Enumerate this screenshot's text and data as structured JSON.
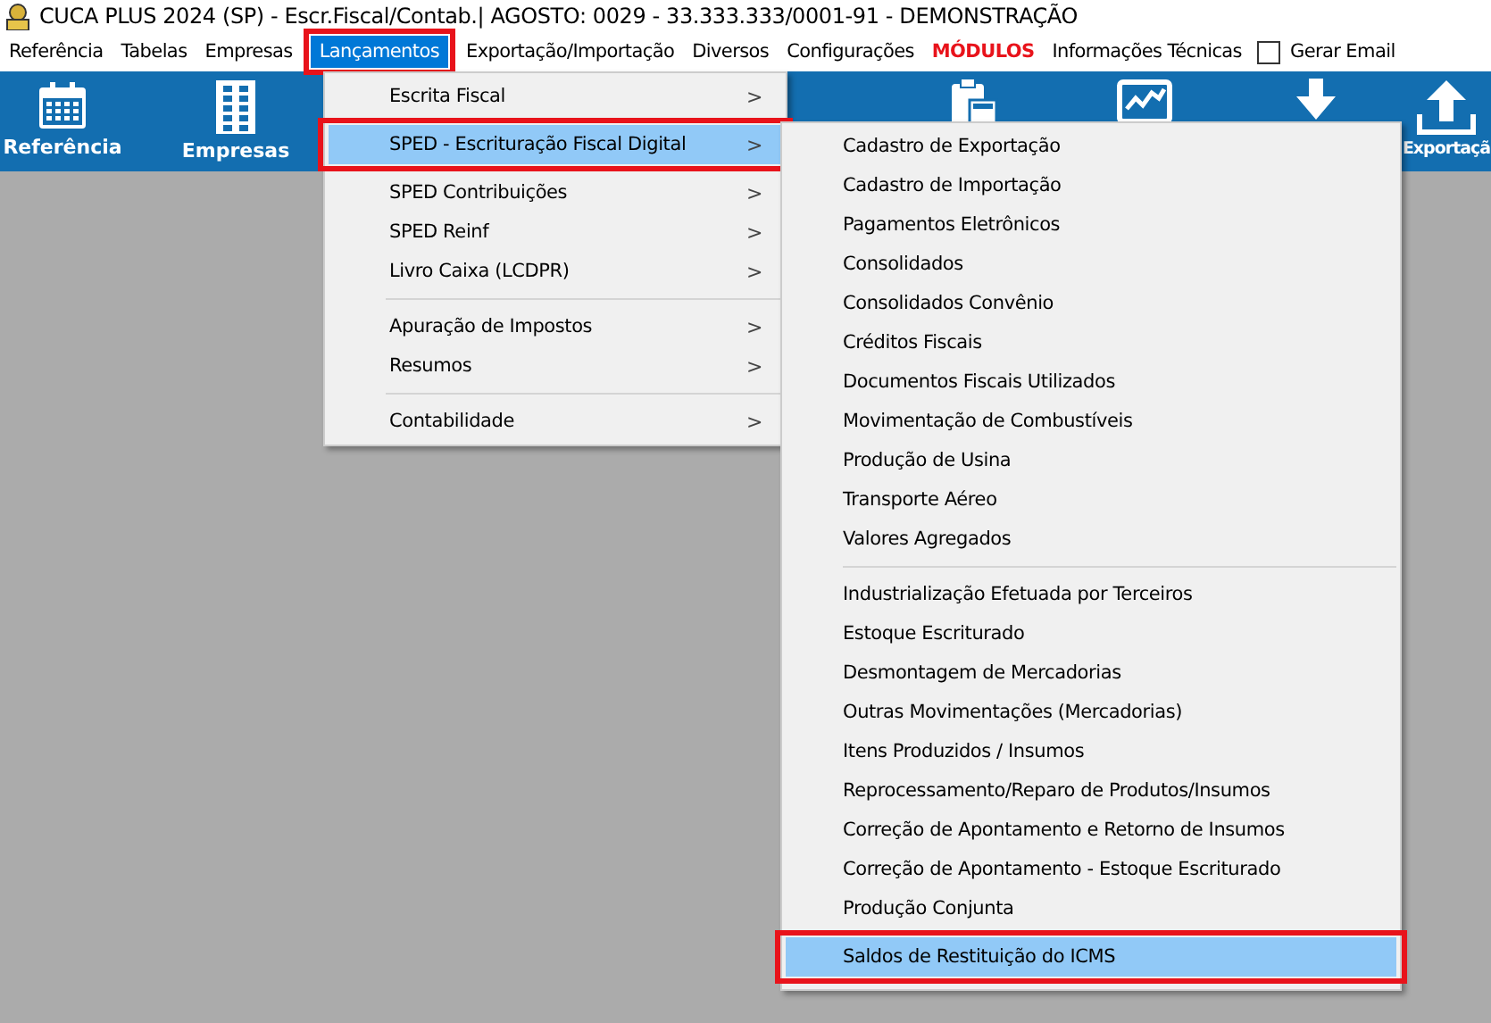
{
  "window": {
    "title": "CUCA PLUS 2024 (SP) - Escr.Fiscal/Contab.| AGOSTO: 0029 - 33.333.333/0001-91 - DEMONSTRAÇÃO"
  },
  "menu_bar": [
    {
      "label": "Referência",
      "selected": false,
      "kind": "plain"
    },
    {
      "label": "Tabelas",
      "selected": false,
      "kind": "plain"
    },
    {
      "label": "Empresas",
      "selected": false,
      "kind": "plain"
    },
    {
      "label": "Lançamentos",
      "selected": true,
      "kind": "plain",
      "annotated": true
    },
    {
      "label": "Exportação/Importação",
      "selected": false,
      "kind": "plain"
    },
    {
      "label": "Diversos",
      "selected": false,
      "kind": "plain"
    },
    {
      "label": "Configurações",
      "selected": false,
      "kind": "plain"
    },
    {
      "label": "MÓDULOS",
      "selected": false,
      "kind": "emphasis"
    },
    {
      "label": "Informações Técnicas",
      "selected": false,
      "kind": "plain"
    },
    {
      "label": "Gerar Email",
      "kind": "checkbox",
      "checked": false
    }
  ],
  "toolbar_left": [
    {
      "label": "Referência"
    },
    {
      "label": "Empresas"
    }
  ],
  "toolbar_right": [
    {
      "label": "Exportaçã"
    }
  ],
  "menu": {
    "groups": [
      [
        {
          "label": "Escrita Fiscal",
          "selected": false
        },
        {
          "label": "SPED - Escrituração Fiscal Digital",
          "selected": true,
          "annotated": true
        },
        {
          "label": "SPED Contribuições",
          "selected": false
        },
        {
          "label": "SPED Reinf",
          "selected": false
        },
        {
          "label": "Livro Caixa (LCDPR)",
          "selected": false
        }
      ],
      [
        {
          "label": "Apuração de Impostos",
          "selected": false
        },
        {
          "label": "Resumos",
          "selected": false
        }
      ],
      [
        {
          "label": "Contabilidade",
          "selected": false
        }
      ]
    ],
    "arrow": ">"
  },
  "submenu": {
    "groups": [
      [
        {
          "label": "Cadastro de Exportação",
          "selected": false
        },
        {
          "label": "Cadastro de Importação",
          "selected": false
        },
        {
          "label": "Pagamentos Eletrônicos",
          "selected": false
        },
        {
          "label": "Consolidados",
          "selected": false
        },
        {
          "label": "Consolidados Convênio",
          "selected": false
        },
        {
          "label": "Créditos Fiscais",
          "selected": false
        },
        {
          "label": "Documentos Fiscais Utilizados",
          "selected": false
        },
        {
          "label": "Movimentação de Combustíveis",
          "selected": false
        },
        {
          "label": "Produção de Usina",
          "selected": false
        },
        {
          "label": "Transporte Aéreo",
          "selected": false
        },
        {
          "label": "Valores Agregados",
          "selected": false
        }
      ],
      [
        {
          "label": "Industrialização Efetuada por Terceiros",
          "selected": false
        },
        {
          "label": "Estoque Escriturado",
          "selected": false
        },
        {
          "label": "Desmontagem de Mercadorias",
          "selected": false
        },
        {
          "label": "Outras Movimentações (Mercadorias)",
          "selected": false
        },
        {
          "label": "Itens Produzidos / Insumos",
          "selected": false
        },
        {
          "label": "Reprocessamento/Reparo de Produtos/Insumos",
          "selected": false
        },
        {
          "label": "Correção de Apontamento e Retorno de Insumos",
          "selected": false
        },
        {
          "label": "Correção de Apontamento - Estoque Escriturado",
          "selected": false
        },
        {
          "label": "Produção Conjunta",
          "selected": false
        },
        {
          "label": "Saldos de Restituição do ICMS",
          "selected": true,
          "annotated": true
        }
      ]
    ]
  }
}
